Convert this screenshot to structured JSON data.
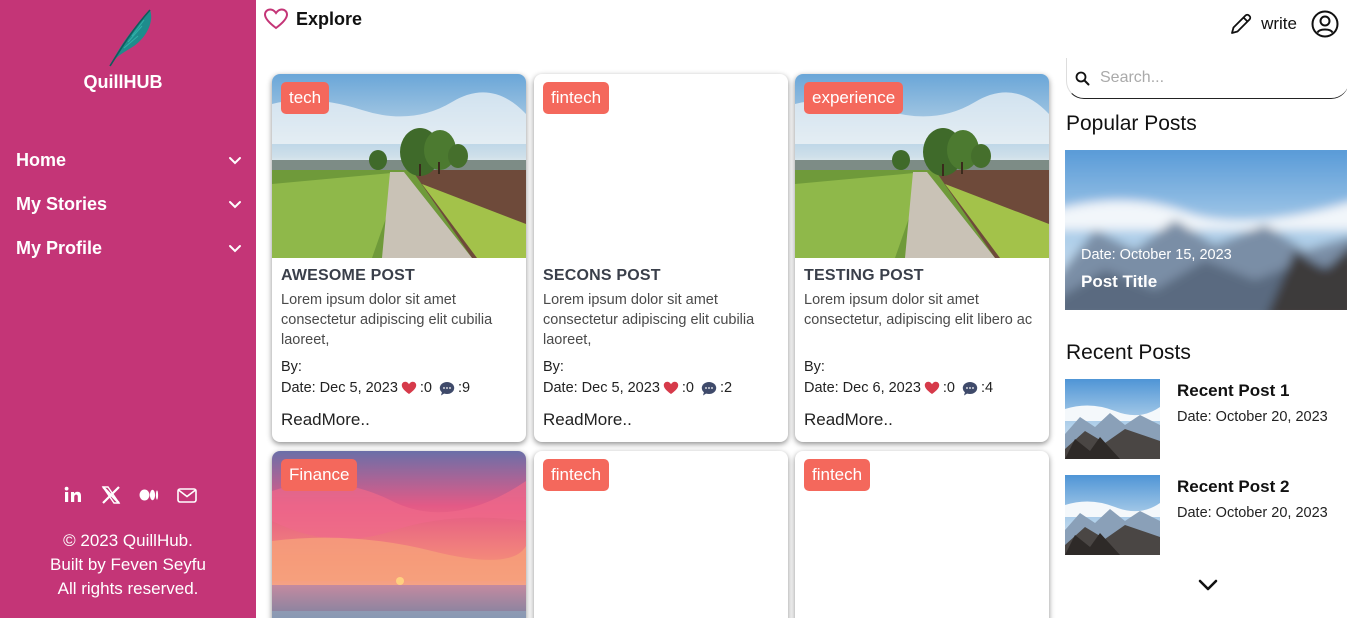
{
  "brand": {
    "name": "QuillHUB"
  },
  "nav": {
    "items": [
      {
        "label": "Home"
      },
      {
        "label": "My Stories"
      },
      {
        "label": "My Profile"
      }
    ]
  },
  "footer": {
    "line1": "© 2023 QuillHub.",
    "line2": "Built by Feven Seyfu",
    "line3": "All rights reserved."
  },
  "header": {
    "title": "Explore",
    "write_label": "write"
  },
  "posts": [
    {
      "tag": "tech",
      "title": "AWESOME POST",
      "excerpt": "Lorem ipsum dolor sit amet consectetur adipiscing elit cubilia laoreet,",
      "by": "By:",
      "date": "Date: Dec 5, 2023",
      "likes": ":0",
      "comments": ":9",
      "readmore": "ReadMore..",
      "image": "road-landscape"
    },
    {
      "tag": "fintech",
      "title": "SECONS POST",
      "excerpt": "Lorem ipsum dolor sit amet consectetur adipiscing elit cubilia laoreet,",
      "by": "By:",
      "date": "Date: Dec 5, 2023",
      "likes": ":0",
      "comments": ":2",
      "readmore": "ReadMore..",
      "image": ""
    },
    {
      "tag": "experience",
      "title": "TESTING POST",
      "excerpt": "Lorem ipsum dolor sit amet consectetur, adipiscing elit libero ac",
      "by": "By:",
      "date": "Date: Dec 6, 2023",
      "likes": ":0",
      "comments": ":4",
      "readmore": "ReadMore..",
      "image": "road-landscape"
    },
    {
      "tag": "Finance",
      "image": "sunset-sea"
    },
    {
      "tag": "fintech",
      "image": ""
    },
    {
      "tag": "fintech",
      "image": ""
    }
  ],
  "sidebar_right": {
    "search_placeholder": "Search...",
    "popular_heading": "Popular Posts",
    "popular": {
      "date": "Date: October 15, 2023",
      "title": "Post Title"
    },
    "recent_heading": "Recent Posts",
    "recent": [
      {
        "title": "Recent Post 1",
        "date": "Date: October 20, 2023"
      },
      {
        "title": "Recent Post 2",
        "date": "Date: October 20, 2023"
      }
    ]
  },
  "colors": {
    "sidebar_bg": "#c43577",
    "tag_bg": "#f4685c",
    "heart": "#d63a4a",
    "comment": "#3f4a6a"
  },
  "icons": [
    "feather-logo-icon",
    "chevron-down-icon",
    "linkedin-icon",
    "x-icon",
    "medium-icon",
    "mail-icon",
    "heart-outline-icon",
    "pencil-icon",
    "user-circle-icon",
    "search-icon",
    "heart-icon",
    "comment-icon"
  ]
}
